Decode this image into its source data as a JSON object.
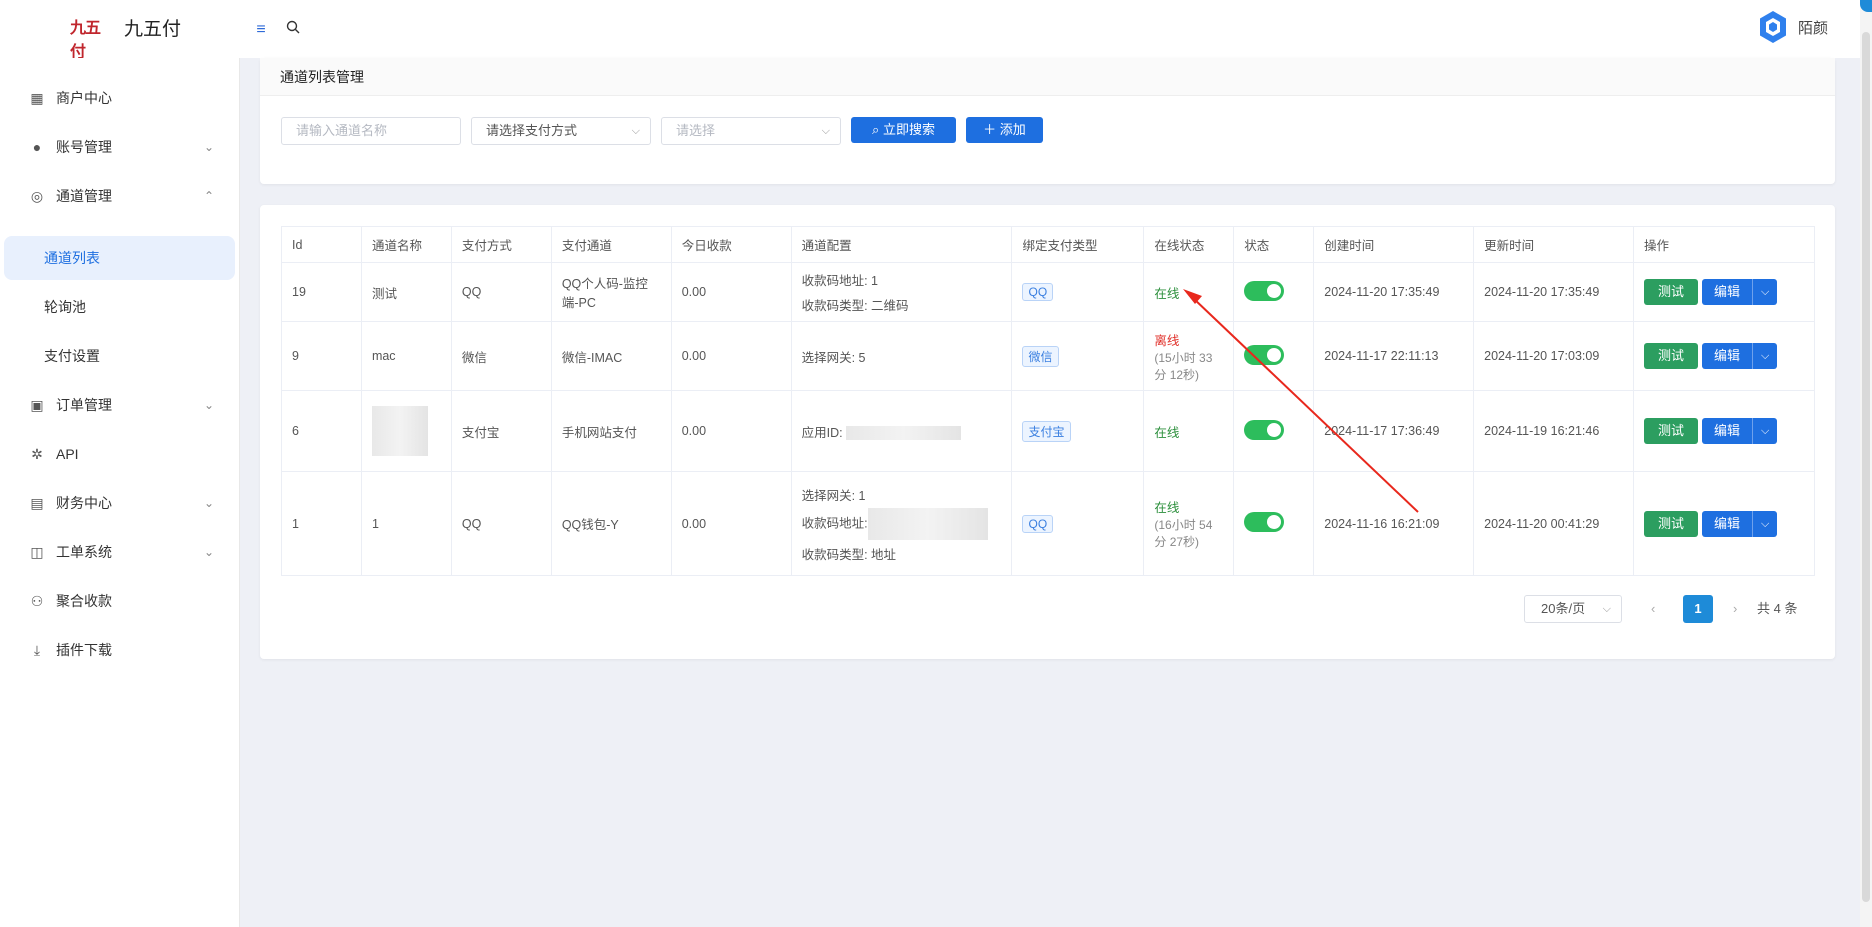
{
  "app": {
    "logo_text": "九五付",
    "logo_mark": "九五付"
  },
  "topbar": {
    "menu_icon": "menu-icon",
    "search_icon": "search-icon",
    "user_name": "陌颜"
  },
  "sidebar": {
    "items": [
      {
        "label": "商户中心",
        "icon": "grid-icon"
      },
      {
        "label": "账号管理",
        "icon": "user-icon"
      },
      {
        "label": "通道管理",
        "icon": "channel-icon"
      },
      {
        "label": "通道列表"
      },
      {
        "label": "轮询池"
      },
      {
        "label": "支付设置"
      },
      {
        "label": "订单管理",
        "icon": "order-icon"
      },
      {
        "label": "API",
        "icon": "api-icon"
      },
      {
        "label": "财务中心",
        "icon": "finance-icon"
      },
      {
        "label": "工单系统",
        "icon": "ticket-icon"
      },
      {
        "label": "聚合收款",
        "icon": "collect-icon"
      },
      {
        "label": "插件下载",
        "icon": "download-icon"
      }
    ]
  },
  "filter": {
    "title": "通道列表管理",
    "name_placeholder": "请输入通道名称",
    "pay_method_placeholder": "请选择支付方式",
    "select_placeholder": "请选择",
    "search_label": "立即搜索",
    "add_label": "添加"
  },
  "table": {
    "headers": [
      "Id",
      "通道名称",
      "支付方式",
      "支付通道",
      "今日收款",
      "通道配置",
      "绑定支付类型",
      "在线状态",
      "状态",
      "创建时间",
      "更新时间",
      "操作"
    ],
    "rows": [
      {
        "id": "19",
        "name": "测试",
        "method": "QQ",
        "channel": "QQ个人码-监控端-PC",
        "today": "0.00",
        "config1": "收款码地址: 1",
        "config2": "收款码类型: 二维码",
        "type": "QQ",
        "online": "在线",
        "online_sub": "",
        "created": "2024-11-20 17:35:49",
        "updated": "2024-11-20 17:35:49"
      },
      {
        "id": "9",
        "name": "mac",
        "method": "微信",
        "channel": "微信-IMAC",
        "today": "0.00",
        "config1": "选择网关: 5",
        "config2": "",
        "type": "微信",
        "online": "离线",
        "online_sub": "(15小时 33 分 12秒)",
        "created": "2024-11-17 22:11:13",
        "updated": "2024-11-20 17:03:09"
      },
      {
        "id": "6",
        "name": "",
        "method": "支付宝",
        "channel": "手机网站支付",
        "today": "0.00",
        "config1": "应用ID:",
        "config2": "",
        "type": "支付宝",
        "online": "在线",
        "online_sub": "",
        "created": "2024-11-17 17:36:49",
        "updated": "2024-11-19 16:21:46"
      },
      {
        "id": "1",
        "name": "1",
        "method": "QQ",
        "channel": "QQ钱包-Y",
        "today": "0.00",
        "config1": "选择网关: 1",
        "config2": "收款码类型: 地址",
        "config_mid": "收款码地址:",
        "type": "QQ",
        "online": "在线",
        "online_sub": "(16小时 54 分 27秒)",
        "created": "2024-11-16 16:21:09",
        "updated": "2024-11-20 00:41:29"
      }
    ],
    "test_label": "测试",
    "edit_label": "编辑"
  },
  "pager": {
    "page_size": "20条/页",
    "current": "1",
    "total": "共 4 条"
  },
  "colors": {
    "primary": "#1e6fe0",
    "success": "#2c9e60",
    "online": "#2b8f3b",
    "offline": "#e0302a",
    "annotation_arrow": "#e8281d"
  }
}
